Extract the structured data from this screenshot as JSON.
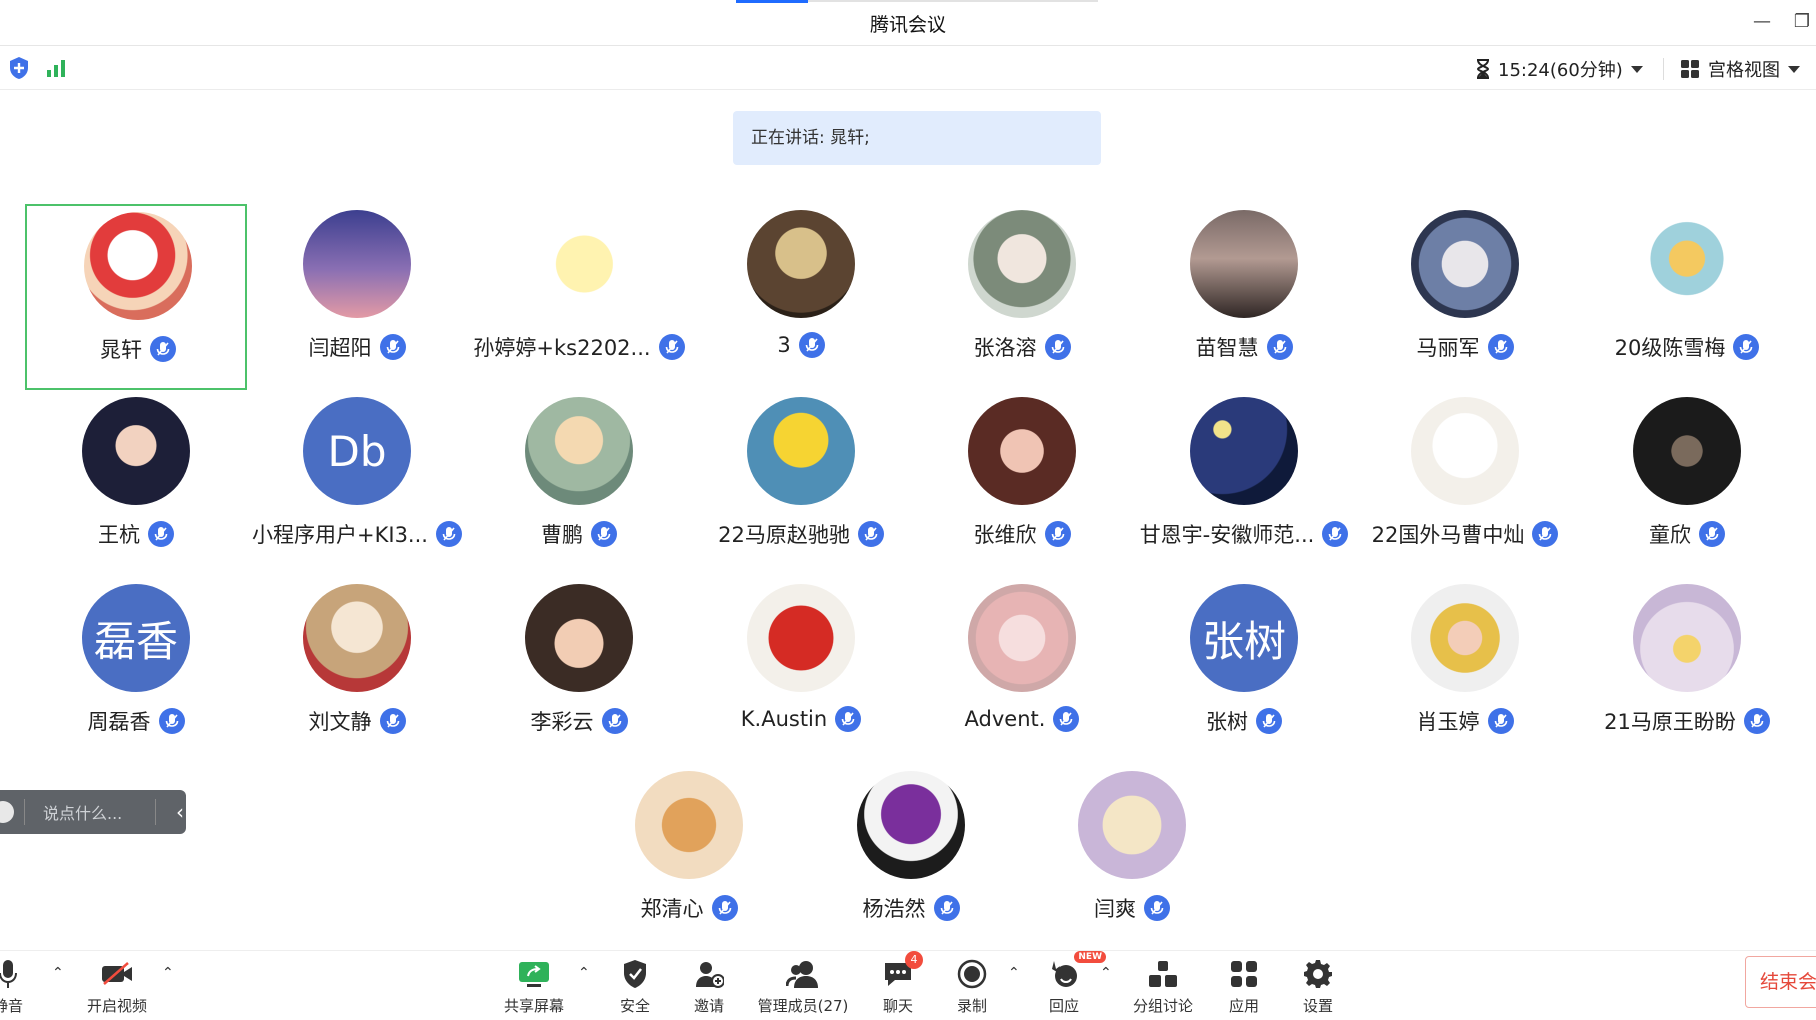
{
  "window": {
    "title": "腾讯会议"
  },
  "topbar": {
    "timer": "15:24(60分钟)",
    "view_mode": "宫格视图"
  },
  "speaking": {
    "text": "正在讲话: 晁轩;"
  },
  "participants": [
    {
      "name": "晁轩",
      "avatar": "crayon-shin-chan",
      "active": true
    },
    {
      "name": "闫超阳",
      "avatar": "lamp-dusk"
    },
    {
      "name": "孙婷婷+ks2202...",
      "avatar": "duck-cartoon"
    },
    {
      "name": "3",
      "avatar": "painting"
    },
    {
      "name": "张洛溶",
      "avatar": "anime-girl"
    },
    {
      "name": "苗智慧",
      "avatar": "book"
    },
    {
      "name": "马丽军",
      "avatar": "girl-selfie"
    },
    {
      "name": "20级陈雪梅",
      "avatar": "cartoon-boy"
    },
    {
      "name": "王杭",
      "avatar": "girl-portrait"
    },
    {
      "name": "小程序用户+KI3...",
      "avatar_text": "Db"
    },
    {
      "name": "曹鹏",
      "avatar": "cartoon-dad"
    },
    {
      "name": "22马原赵驰驰",
      "avatar": "lisa-simpson"
    },
    {
      "name": "张维欣",
      "avatar": "girl-portrait-2"
    },
    {
      "name": "甘恩宇-安徽师范...",
      "avatar": "starry-night"
    },
    {
      "name": "22国外马曹中灿",
      "avatar": "cartoon-face"
    },
    {
      "name": "童欣",
      "avatar": "dark-hair"
    },
    {
      "name": "周磊香",
      "avatar_text": "磊香"
    },
    {
      "name": "刘文静",
      "avatar": "dog-in-bag"
    },
    {
      "name": "李彩云",
      "avatar": "child"
    },
    {
      "name": "K.Austin",
      "avatar": "red-square"
    },
    {
      "name": "Advent.",
      "avatar": "anime-girl-2"
    },
    {
      "name": "张树",
      "avatar_text": "张树"
    },
    {
      "name": "肖玉婷",
      "avatar": "girl-sunglasses"
    },
    {
      "name": "21马原王盼盼",
      "avatar": "bunny-flower"
    },
    {
      "name": "郑清心",
      "avatar": "corgi"
    },
    {
      "name": "杨浩然",
      "avatar": "cartoon-umbrella"
    },
    {
      "name": "闫爽",
      "avatar": "garlic-cartoon"
    }
  ],
  "chat": {
    "placeholder": "说点什么..."
  },
  "toolbar": {
    "mute": "静音",
    "video": "开启视频",
    "share": "共享屏幕",
    "security": "安全",
    "invite": "邀请",
    "members": "管理成员(27)",
    "chat": "聊天",
    "chat_badge": "4",
    "record": "录制",
    "reaction": "回应",
    "reaction_tag": "NEW",
    "breakout": "分组讨论",
    "apps": "应用",
    "settings": "设置",
    "end": "结束会议"
  },
  "colors": {
    "accent": "#3f71e8",
    "active_border": "#4cc26a",
    "end": "#e5483a"
  }
}
